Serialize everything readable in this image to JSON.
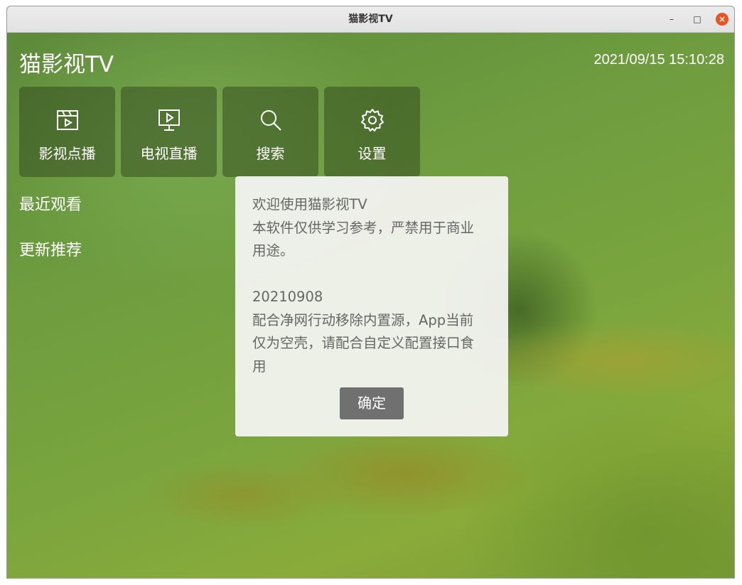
{
  "window": {
    "title": "猫影视TV",
    "controls": {
      "minimize": "–",
      "maximize": "□",
      "close": "×"
    }
  },
  "header": {
    "app_title": "猫影视TV",
    "datetime": "2021/09/15 15:10:28"
  },
  "tiles": [
    {
      "label": "影视点播",
      "icon": "film-clapper-icon"
    },
    {
      "label": "电视直播",
      "icon": "tv-play-icon"
    },
    {
      "label": "搜索",
      "icon": "search-icon"
    },
    {
      "label": "设置",
      "icon": "gear-icon"
    }
  ],
  "sections": {
    "recent": "最近观看",
    "updates": "更新推荐"
  },
  "dialog": {
    "message": "欢迎使用猫影视TV\n本软件仅供学习参考，严禁用于商业\n用途。\n\n20210908\n配合净网行动移除内置源，App当前\n仅为空壳，请配合自定义配置接口食\n用",
    "ok_label": "确定"
  },
  "colors": {
    "titlebar": "#e6e6e6",
    "close_button": "#e95420",
    "tile_background": "rgba(40,60,25,0.45)",
    "dialog_background": "#f4f4f2",
    "dialog_text": "#666666",
    "ok_button": "#707070"
  }
}
